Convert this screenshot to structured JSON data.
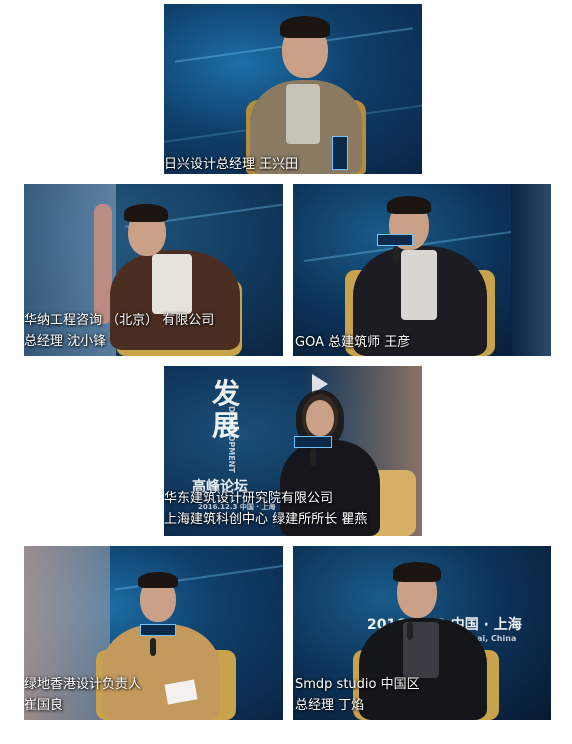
{
  "photos": [
    {
      "caption_lines": [
        "日兴设计总经理 王兴田"
      ]
    },
    {
      "caption_lines": [
        "华纳工程咨询 （北京） 有限公司",
        "总经理 沈小锋"
      ]
    },
    {
      "caption_lines": [
        "GOA 总建筑师 王彦"
      ]
    },
    {
      "caption_lines": [
        "华东建筑设计研究院有限公司",
        "上海建筑科创中心 绿建所所长 瞿燕"
      ],
      "backdrop_text": [
        "发",
        "展",
        "高峰论坛",
        "2016.12.3 中国 · 上海",
        "DEVELOPMENT"
      ]
    },
    {
      "caption_lines": [
        "绿地香港设计负责人",
        "崔国良"
      ]
    },
    {
      "caption_lines": [
        "Smdp studio 中国区",
        "总经理 丁焰"
      ],
      "backdrop_text": [
        "2016.12.3 中国 · 上海",
        "Shanghai, China"
      ]
    }
  ],
  "colors": {
    "backdrop_blue": "#0f3f6b",
    "chair_gold": "#c9a24c",
    "caption_text": "#ffffff"
  }
}
